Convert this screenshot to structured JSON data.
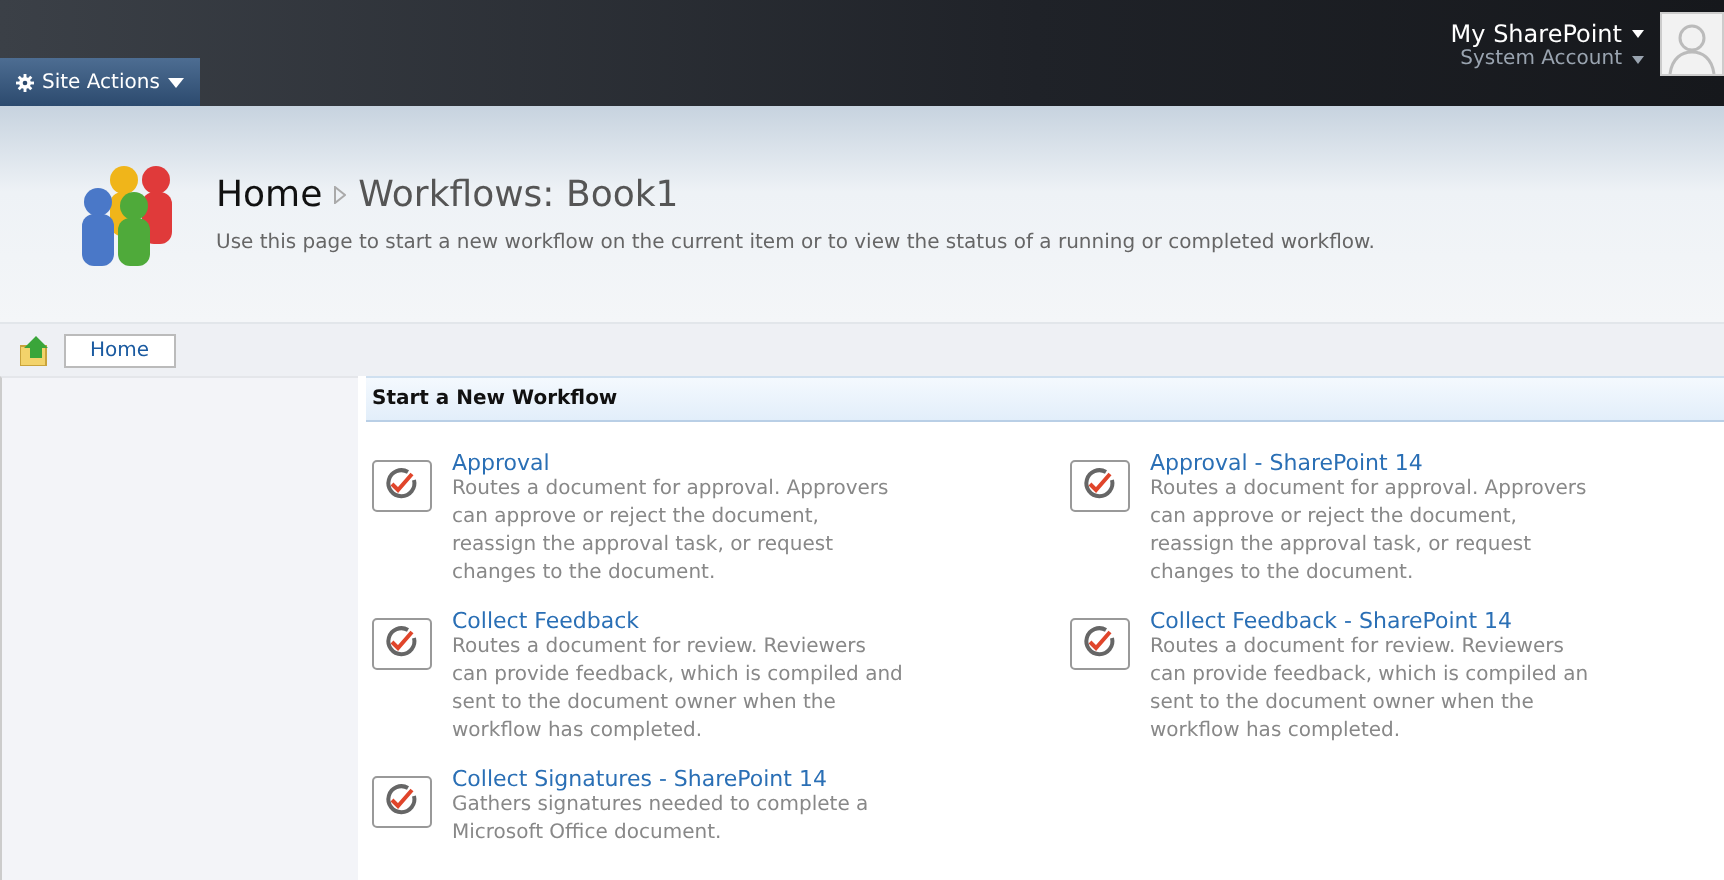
{
  "top_bar": {
    "site_actions": "Site Actions",
    "my_sharepoint": "My SharePoint",
    "account": "System Account"
  },
  "header": {
    "breadcrumb": [
      {
        "label": "Home"
      },
      {
        "label": "Workflows: Book1"
      }
    ],
    "description": "Use this page to start a new workflow on the current item or to view the status of a running or completed workflow."
  },
  "nav": {
    "home": "Home"
  },
  "section": {
    "title": "Start a New Workflow",
    "workflows": [
      {
        "name": "Approval",
        "lines": [
          "Routes a document for approval. Approvers",
          "can approve or reject the document,",
          "reassign the approval task, or request",
          "changes to the document."
        ]
      },
      {
        "name": "Approval - SharePoint 14",
        "lines": [
          "Routes a document for approval. Approvers",
          "can approve or reject the document,",
          "reassign the approval task, or request",
          "changes to the document."
        ]
      },
      {
        "name": "Collect Feedback",
        "lines": [
          "Routes a document for review. Reviewers",
          "can provide feedback, which is compiled and",
          "sent to the document owner when the",
          "workflow has completed."
        ]
      },
      {
        "name": "Collect Feedback - SharePoint 14",
        "lines": [
          "Routes a document for review. Reviewers",
          "can provide feedback, which is compiled an",
          "sent to the document owner when the",
          "workflow has completed."
        ]
      },
      {
        "name": "Collect Signatures - SharePoint 14",
        "lines": [
          "Gathers signatures needed to complete a",
          "Microsoft Office document."
        ]
      }
    ]
  }
}
